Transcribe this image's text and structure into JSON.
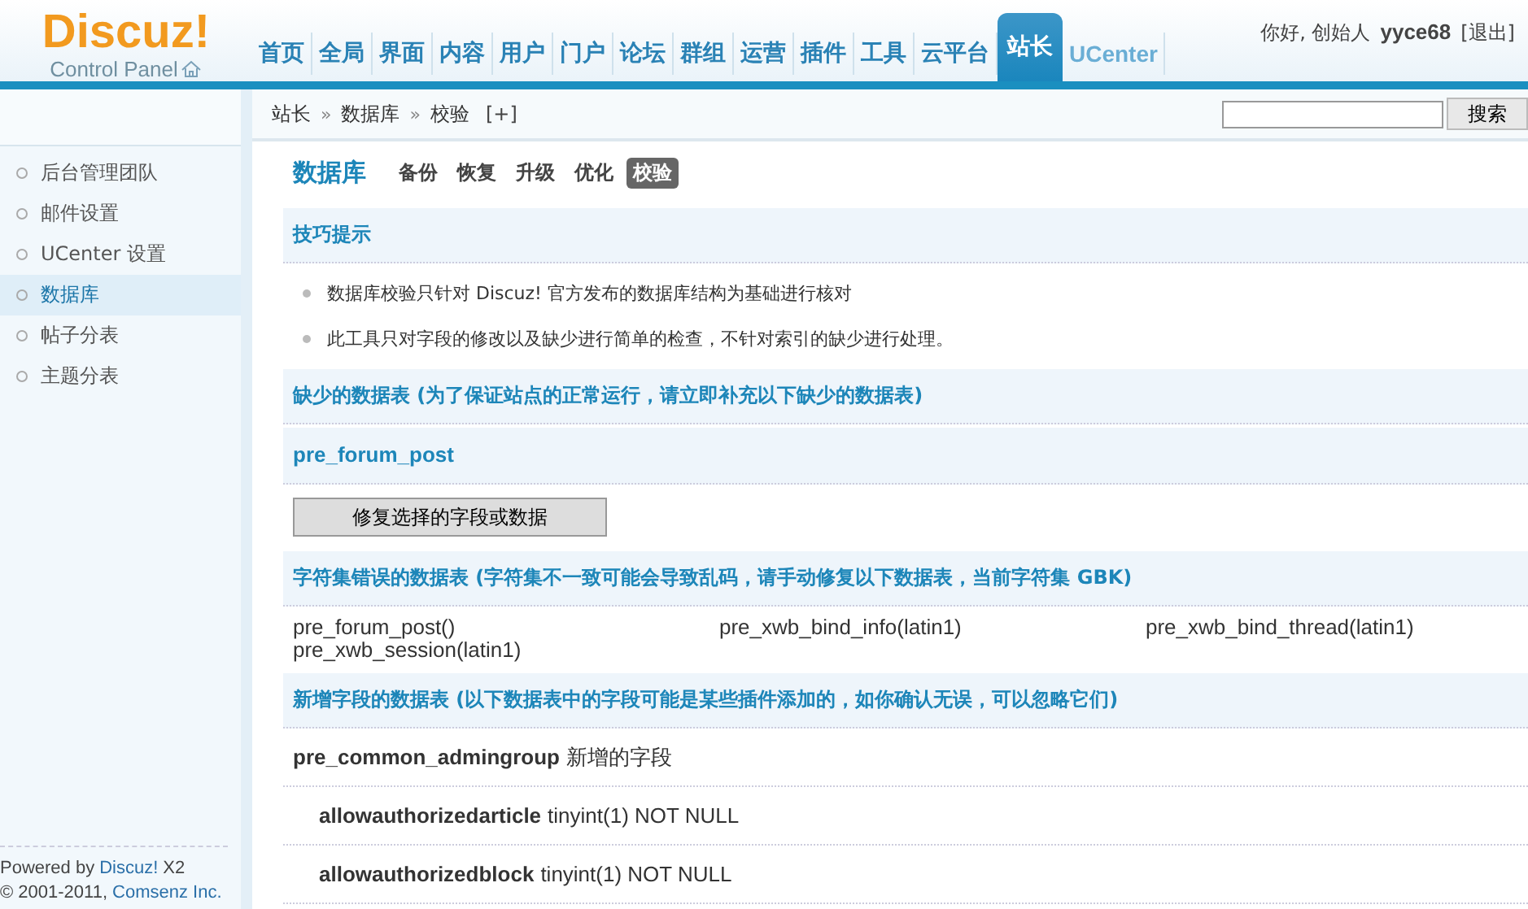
{
  "logo": {
    "name": "Discuz!",
    "subtitle": "Control Panel"
  },
  "nav": [
    {
      "label": "首页",
      "selected": false
    },
    {
      "label": "全局",
      "selected": false
    },
    {
      "label": "界面",
      "selected": false
    },
    {
      "label": "内容",
      "selected": false
    },
    {
      "label": "用户",
      "selected": false
    },
    {
      "label": "门户",
      "selected": false
    },
    {
      "label": "论坛",
      "selected": false
    },
    {
      "label": "群组",
      "selected": false
    },
    {
      "label": "运营",
      "selected": false
    },
    {
      "label": "插件",
      "selected": false
    },
    {
      "label": "工具",
      "selected": false
    },
    {
      "label": "云平台",
      "selected": false
    },
    {
      "label": "站长",
      "selected": true
    },
    {
      "label": "UCenter",
      "selected": false
    }
  ],
  "user": {
    "greeting": "你好, 创始人",
    "name": "yyce68",
    "logout": "[退出]"
  },
  "breadcrumb": {
    "items": [
      "站长",
      "数据库",
      "校验"
    ],
    "separator": "»",
    "add": "[+]"
  },
  "search": {
    "button": "搜索"
  },
  "sidebar": {
    "items": [
      {
        "label": "后台管理团队",
        "selected": false
      },
      {
        "label": "邮件设置",
        "selected": false
      },
      {
        "label": "UCenter 设置",
        "selected": false
      },
      {
        "label": "数据库",
        "selected": true
      },
      {
        "label": "帖子分表",
        "selected": false
      },
      {
        "label": "主题分表",
        "selected": false
      }
    ],
    "footer": [
      {
        "prefix": "Powered by",
        "link": "Discuz!",
        "suffix": "X2"
      },
      {
        "prefix": "© 2001-2011,",
        "link": "Comsenz Inc."
      }
    ]
  },
  "page": {
    "title": "数据库",
    "tabs": [
      {
        "label": "备份",
        "selected": false
      },
      {
        "label": "恢复",
        "selected": false
      },
      {
        "label": "升级",
        "selected": false
      },
      {
        "label": "优化",
        "selected": false
      },
      {
        "label": "校验",
        "selected": true
      }
    ]
  },
  "tips": {
    "title": "技巧提示",
    "items": [
      "数据库校验只针对  Discuz! 官方发布的数据库结构为基础进行核对",
      "此工具只对字段的修改以及缺少进行简单的检查，不针对索引的缺少进行处理。"
    ]
  },
  "missing": {
    "title": "缺少的数据表 (为了保证站点的正常运行，请立即补充以下缺少的数据表)",
    "tables": [
      "pre_forum_post"
    ],
    "button": "修复选择的字段或数据"
  },
  "charset": {
    "title": "字符集错误的数据表 (字符集不一致可能会导致乱码，请手动修复以下数据表，当前字符集  GBK)",
    "tables": [
      "pre_forum_post()",
      "pre_xwb_bind_info(latin1)",
      "pre_xwb_bind_thread(latin1)",
      "pre_xwb_session(latin1)"
    ]
  },
  "added": {
    "title": "新增字段的数据表 (以下数据表中的字段可能是某些插件添加的，如你确认无误，可以忽略它们)",
    "rows": [
      {
        "kind": "table",
        "name": "pre_common_admingroup",
        "text": "新增的字段"
      },
      {
        "kind": "field",
        "name": "allowauthorizedarticle",
        "text": "tinyint(1) NOT NULL"
      },
      {
        "kind": "field",
        "name": "allowauthorizedblock",
        "text": "tinyint(1) NOT NULL"
      }
    ]
  }
}
